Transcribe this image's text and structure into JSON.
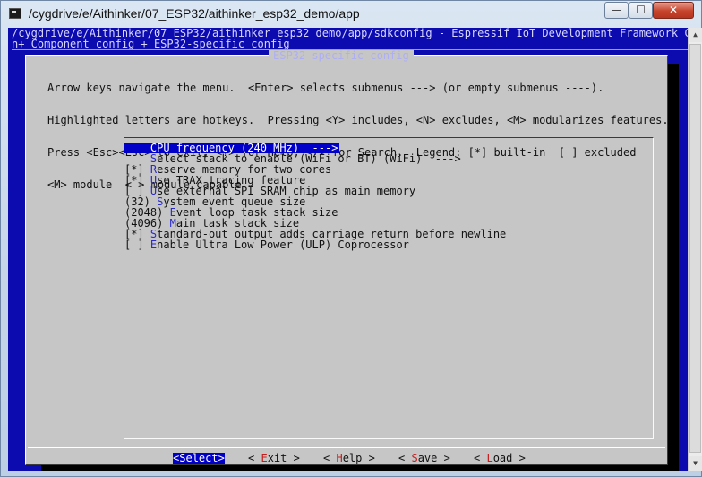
{
  "window": {
    "title": "/cygdrive/e/Aithinker/07_ESP32/aithinker_esp32_demo/app",
    "controls": {
      "minimize": "—",
      "maximize": "☐",
      "close": "✕"
    }
  },
  "terminal": {
    "header_line1": "/cygdrive/e/Aithinker/07_ESP32/aithinker_esp32_demo/app/sdkconfig - Espressif IoT Development Framework Co",
    "header_line2": "n+ Component config + ESP32-specific config"
  },
  "dialog": {
    "title": "ESP32-specific config",
    "help_lines": [
      "Arrow keys navigate the menu.  <Enter> selects submenus ---> (or empty submenus ----).",
      "Highlighted letters are hotkeys.  Pressing <Y> includes, <N> excludes, <M> modularizes features.",
      "Press <Esc><Esc> to exit, <?> for Help, </> for Search.  Legend: [*] built-in  [ ] excluded",
      "<M> module  < > module capable"
    ],
    "items": [
      {
        "prefix": "    ",
        "hot": "C",
        "rest": "PU frequency (240 MHz)  --->",
        "selected": true
      },
      {
        "prefix": "    ",
        "hot": "S",
        "rest": "elect stack to enable (WiFi or BT) (WiFi)  --->",
        "selected": false
      },
      {
        "prefix": "[*] ",
        "hot": "R",
        "rest": "eserve memory for two cores",
        "selected": false
      },
      {
        "prefix": "[*] ",
        "hot": "U",
        "rest": "se TRAX tracing feature",
        "selected": false
      },
      {
        "prefix": "[ ] ",
        "hot": "U",
        "rest": "se external SPI SRAM chip as main memory",
        "selected": false
      },
      {
        "prefix": "(32) ",
        "hot": "S",
        "rest": "ystem event queue size",
        "selected": false
      },
      {
        "prefix": "(2048) ",
        "hot": "E",
        "rest": "vent loop task stack size",
        "selected": false
      },
      {
        "prefix": "(4096) ",
        "hot": "M",
        "rest": "ain task stack size",
        "selected": false
      },
      {
        "prefix": "[*] ",
        "hot": "S",
        "rest": "tandard-out output adds carriage return before newline",
        "selected": false
      },
      {
        "prefix": "[ ] ",
        "hot": "E",
        "rest": "nable Ultra Low Power (ULP) Coprocessor",
        "selected": false
      }
    ],
    "buttons": [
      {
        "pre": "<",
        "hot": "S",
        "rest": "elect>",
        "active": true
      },
      {
        "pre": "< ",
        "hot": "E",
        "rest": "xit >",
        "active": false
      },
      {
        "pre": "< ",
        "hot": "H",
        "rest": "elp >",
        "active": false
      },
      {
        "pre": "< ",
        "hot": "S",
        "rest": "ave >",
        "active": false
      },
      {
        "pre": "< ",
        "hot": "L",
        "rest": "oad >",
        "active": false
      }
    ]
  },
  "colors": {
    "terminal_bg": "#0b0bb0",
    "dialog_bg": "#c6c6c6",
    "selection": "#0000c8",
    "hotkey_menu": "#2a2acc",
    "hotkey_button": "#c71b1b"
  }
}
